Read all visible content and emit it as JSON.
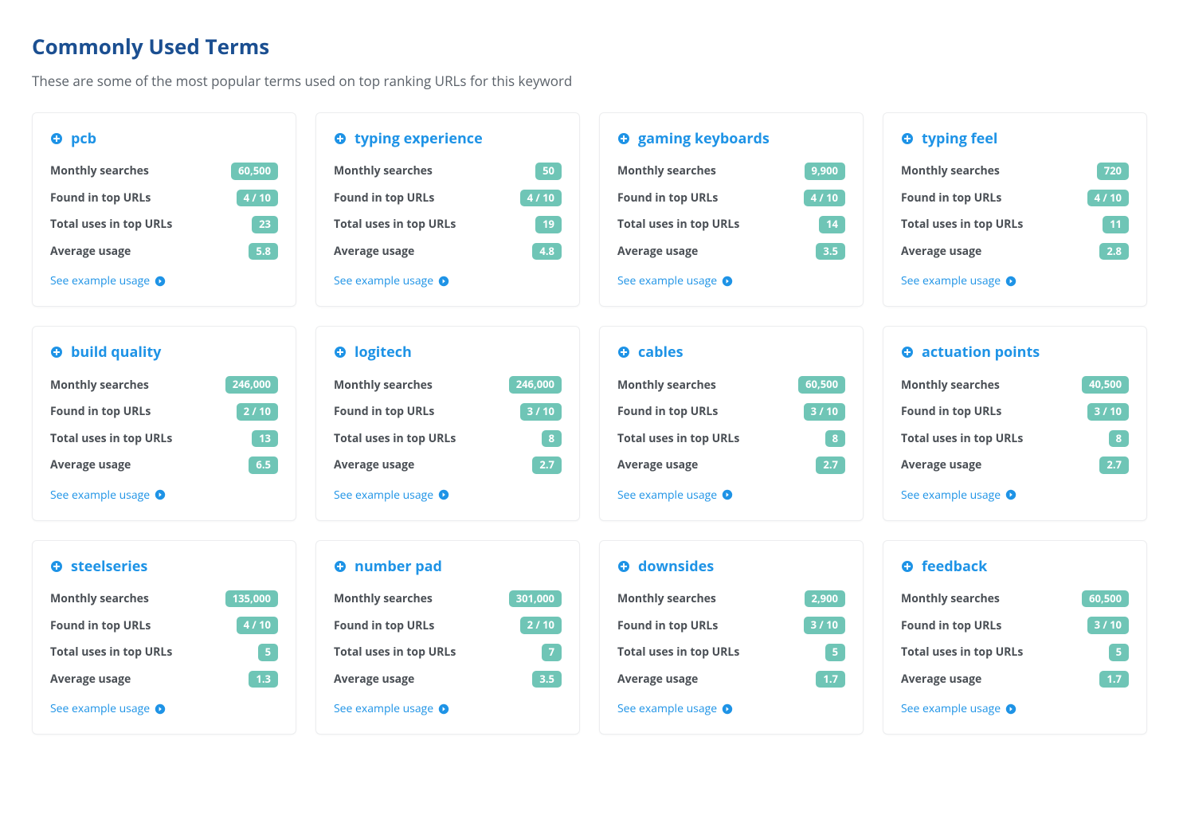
{
  "header": {
    "title": "Commonly Used Terms",
    "subtitle": "These are some of the most popular terms used on top ranking URLs for this keyword"
  },
  "labels": {
    "monthly_searches": "Monthly searches",
    "found_in_top_urls": "Found in top URLs",
    "total_uses": "Total uses in top URLs",
    "average_usage": "Average usage",
    "example_link": "See example usage"
  },
  "terms": [
    {
      "name": "pcb",
      "monthly_searches": "60,500",
      "found_in_top": "4 / 10",
      "total_uses": "23",
      "avg_usage": "5.8"
    },
    {
      "name": "typing experience",
      "monthly_searches": "50",
      "found_in_top": "4 / 10",
      "total_uses": "19",
      "avg_usage": "4.8"
    },
    {
      "name": "gaming keyboards",
      "monthly_searches": "9,900",
      "found_in_top": "4 / 10",
      "total_uses": "14",
      "avg_usage": "3.5"
    },
    {
      "name": "typing feel",
      "monthly_searches": "720",
      "found_in_top": "4 / 10",
      "total_uses": "11",
      "avg_usage": "2.8"
    },
    {
      "name": "build quality",
      "monthly_searches": "246,000",
      "found_in_top": "2 / 10",
      "total_uses": "13",
      "avg_usage": "6.5"
    },
    {
      "name": "logitech",
      "monthly_searches": "246,000",
      "found_in_top": "3 / 10",
      "total_uses": "8",
      "avg_usage": "2.7"
    },
    {
      "name": "cables",
      "monthly_searches": "60,500",
      "found_in_top": "3 / 10",
      "total_uses": "8",
      "avg_usage": "2.7"
    },
    {
      "name": "actuation points",
      "monthly_searches": "40,500",
      "found_in_top": "3 / 10",
      "total_uses": "8",
      "avg_usage": "2.7"
    },
    {
      "name": "steelseries",
      "monthly_searches": "135,000",
      "found_in_top": "4 / 10",
      "total_uses": "5",
      "avg_usage": "1.3"
    },
    {
      "name": "number pad",
      "monthly_searches": "301,000",
      "found_in_top": "2 / 10",
      "total_uses": "7",
      "avg_usage": "3.5"
    },
    {
      "name": "downsides",
      "monthly_searches": "2,900",
      "found_in_top": "3 / 10",
      "total_uses": "5",
      "avg_usage": "1.7"
    },
    {
      "name": "feedback",
      "monthly_searches": "60,500",
      "found_in_top": "3 / 10",
      "total_uses": "5",
      "avg_usage": "1.7"
    }
  ]
}
